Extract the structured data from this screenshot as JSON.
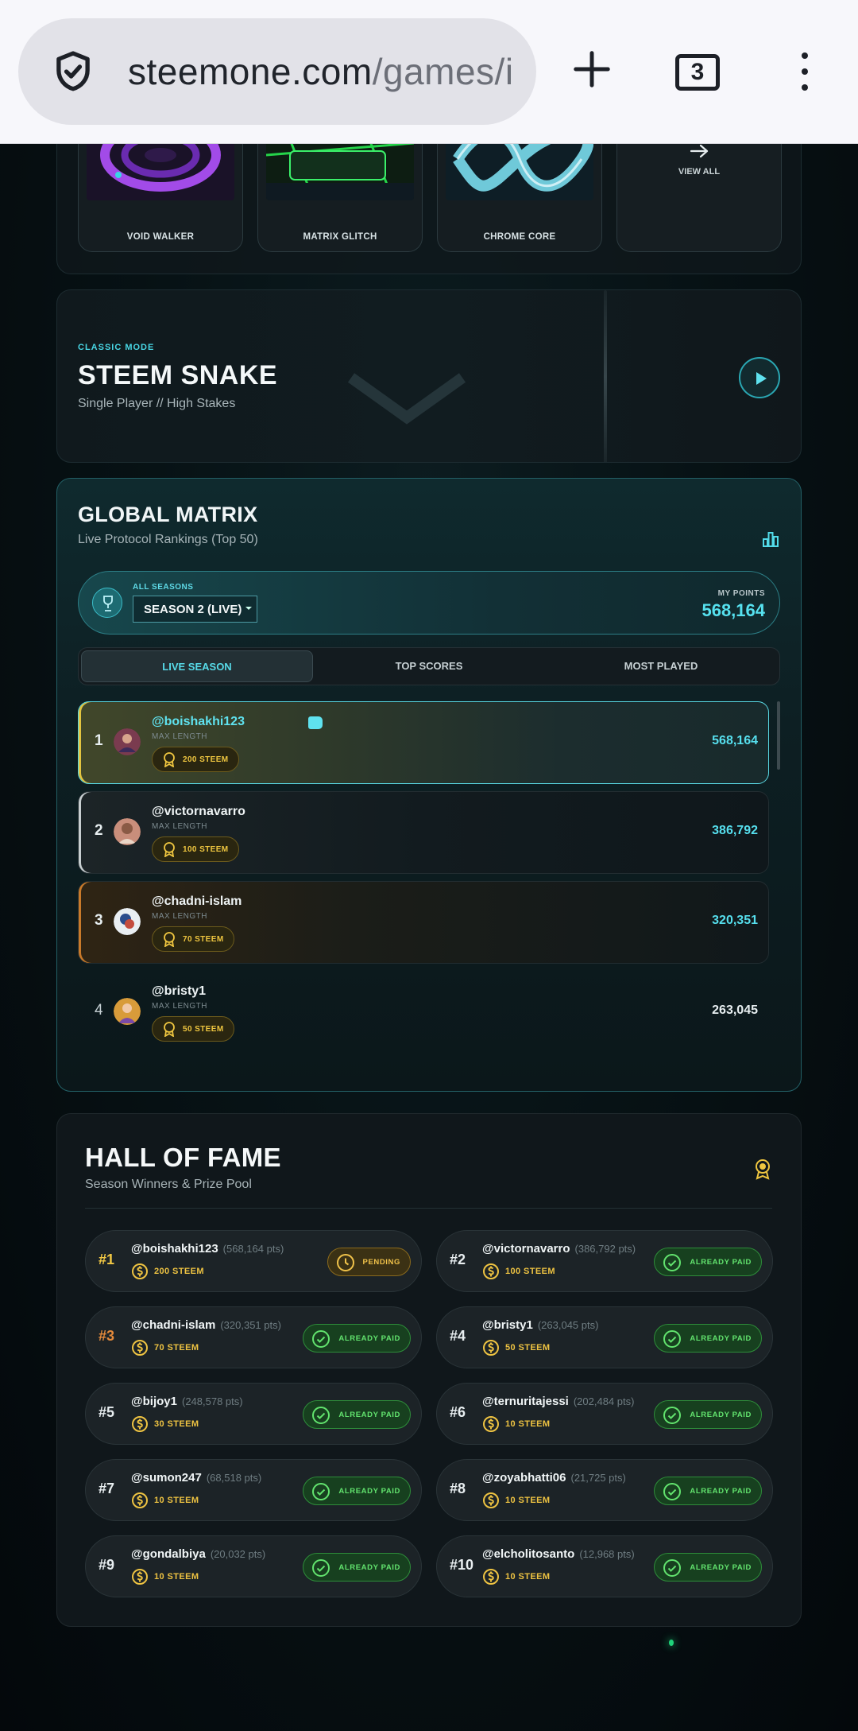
{
  "browser": {
    "url_main": "steemone.com",
    "url_rest": "/games/i",
    "tab_count": "3"
  },
  "gallery": {
    "items": [
      {
        "label": "VOID WALKER"
      },
      {
        "label": "MATRIX GLITCH"
      },
      {
        "label": "CHROME CORE"
      }
    ],
    "view_all": "VIEW ALL"
  },
  "hero": {
    "kicker": "CLASSIC MODE",
    "title": "STEEM SNAKE",
    "subtitle": "Single Player // High Stakes"
  },
  "matrix": {
    "title": "GLOBAL MATRIX",
    "subtitle": "Live Protocol Rankings (Top 50)",
    "season_label": "ALL SEASONS",
    "season_value": "SEASON 2 (LIVE)",
    "my_points_label": "MY POINTS",
    "my_points_value": "568,164",
    "tabs": [
      {
        "label": "LIVE SEASON",
        "active": true
      },
      {
        "label": "TOP SCORES",
        "active": false
      },
      {
        "label": "MOST PLAYED",
        "active": false
      }
    ],
    "rows": [
      {
        "rank": "1",
        "user": "@boishakhi123",
        "meta": "MAX LENGTH",
        "prize": "200 STEEM",
        "score": "568,164"
      },
      {
        "rank": "2",
        "user": "@victornavarro",
        "meta": "MAX LENGTH",
        "prize": "100 STEEM",
        "score": "386,792"
      },
      {
        "rank": "3",
        "user": "@chadni-islam",
        "meta": "MAX LENGTH",
        "prize": "70 STEEM",
        "score": "320,351"
      },
      {
        "rank": "4",
        "user": "@bristy1",
        "meta": "MAX LENGTH",
        "prize": "50 STEEM",
        "score": "263,045"
      }
    ]
  },
  "fame": {
    "title": "HALL OF FAME",
    "subtitle": "Season Winners & Prize Pool",
    "winners": [
      {
        "pos": "#1",
        "user": "@boishakhi123",
        "pts": "(568,164 pts)",
        "prize": "200 STEEM",
        "status": "PENDING"
      },
      {
        "pos": "#2",
        "user": "@victornavarro",
        "pts": "(386,792 pts)",
        "prize": "100 STEEM",
        "status": "ALREADY PAID"
      },
      {
        "pos": "#3",
        "user": "@chadni-islam",
        "pts": "(320,351 pts)",
        "prize": "70 STEEM",
        "status": "ALREADY PAID"
      },
      {
        "pos": "#4",
        "user": "@bristy1",
        "pts": "(263,045 pts)",
        "prize": "50 STEEM",
        "status": "ALREADY PAID"
      },
      {
        "pos": "#5",
        "user": "@bijoy1",
        "pts": "(248,578 pts)",
        "prize": "30 STEEM",
        "status": "ALREADY PAID"
      },
      {
        "pos": "#6",
        "user": "@ternuritajessi",
        "pts": "(202,484 pts)",
        "prize": "10 STEEM",
        "status": "ALREADY PAID"
      },
      {
        "pos": "#7",
        "user": "@sumon247",
        "pts": "(68,518 pts)",
        "prize": "10 STEEM",
        "status": "ALREADY PAID"
      },
      {
        "pos": "#8",
        "user": "@zoyabhatti06",
        "pts": "(21,725 pts)",
        "prize": "10 STEEM",
        "status": "ALREADY PAID"
      },
      {
        "pos": "#9",
        "user": "@gondalbiya",
        "pts": "(20,032 pts)",
        "prize": "10 STEEM",
        "status": "ALREADY PAID"
      },
      {
        "pos": "#10",
        "user": "@elcholitosanto",
        "pts": "(12,968 pts)",
        "prize": "10 STEEM",
        "status": "ALREADY PAID"
      }
    ]
  },
  "colors": {
    "accent": "#56dfee",
    "gold": "#eec342",
    "paid": "#62e36e"
  }
}
